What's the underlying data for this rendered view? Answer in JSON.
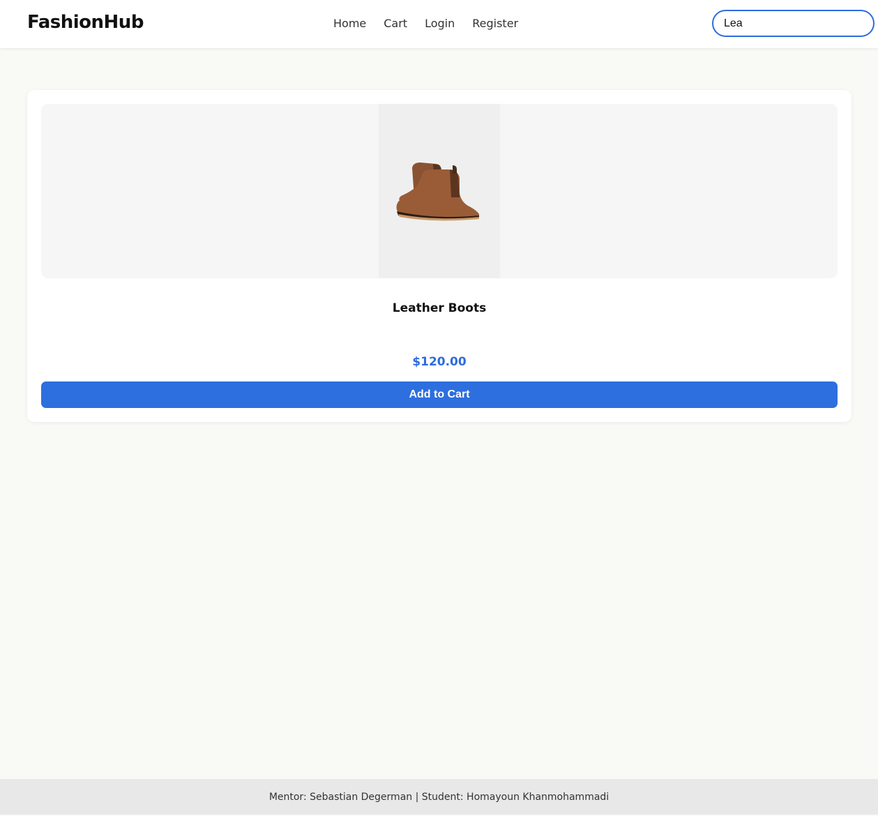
{
  "header": {
    "brand": "FashionHub",
    "nav": [
      {
        "label": "Home"
      },
      {
        "label": "Cart"
      },
      {
        "label": "Login"
      },
      {
        "label": "Register"
      }
    ],
    "search": {
      "value": "Lea",
      "placeholder": ""
    }
  },
  "product": {
    "name": "Leather Boots",
    "price": "$120.00",
    "button_label": "Add to Cart",
    "image_icon": "leather-boots-image"
  },
  "footer": {
    "text": "Mentor: Sebastian Degerman | Student: Homayoun Khanmohammadi"
  },
  "colors": {
    "accent": "#2d6fde",
    "background": "#f9f9f6",
    "footer_bg": "#e8e8e8"
  }
}
